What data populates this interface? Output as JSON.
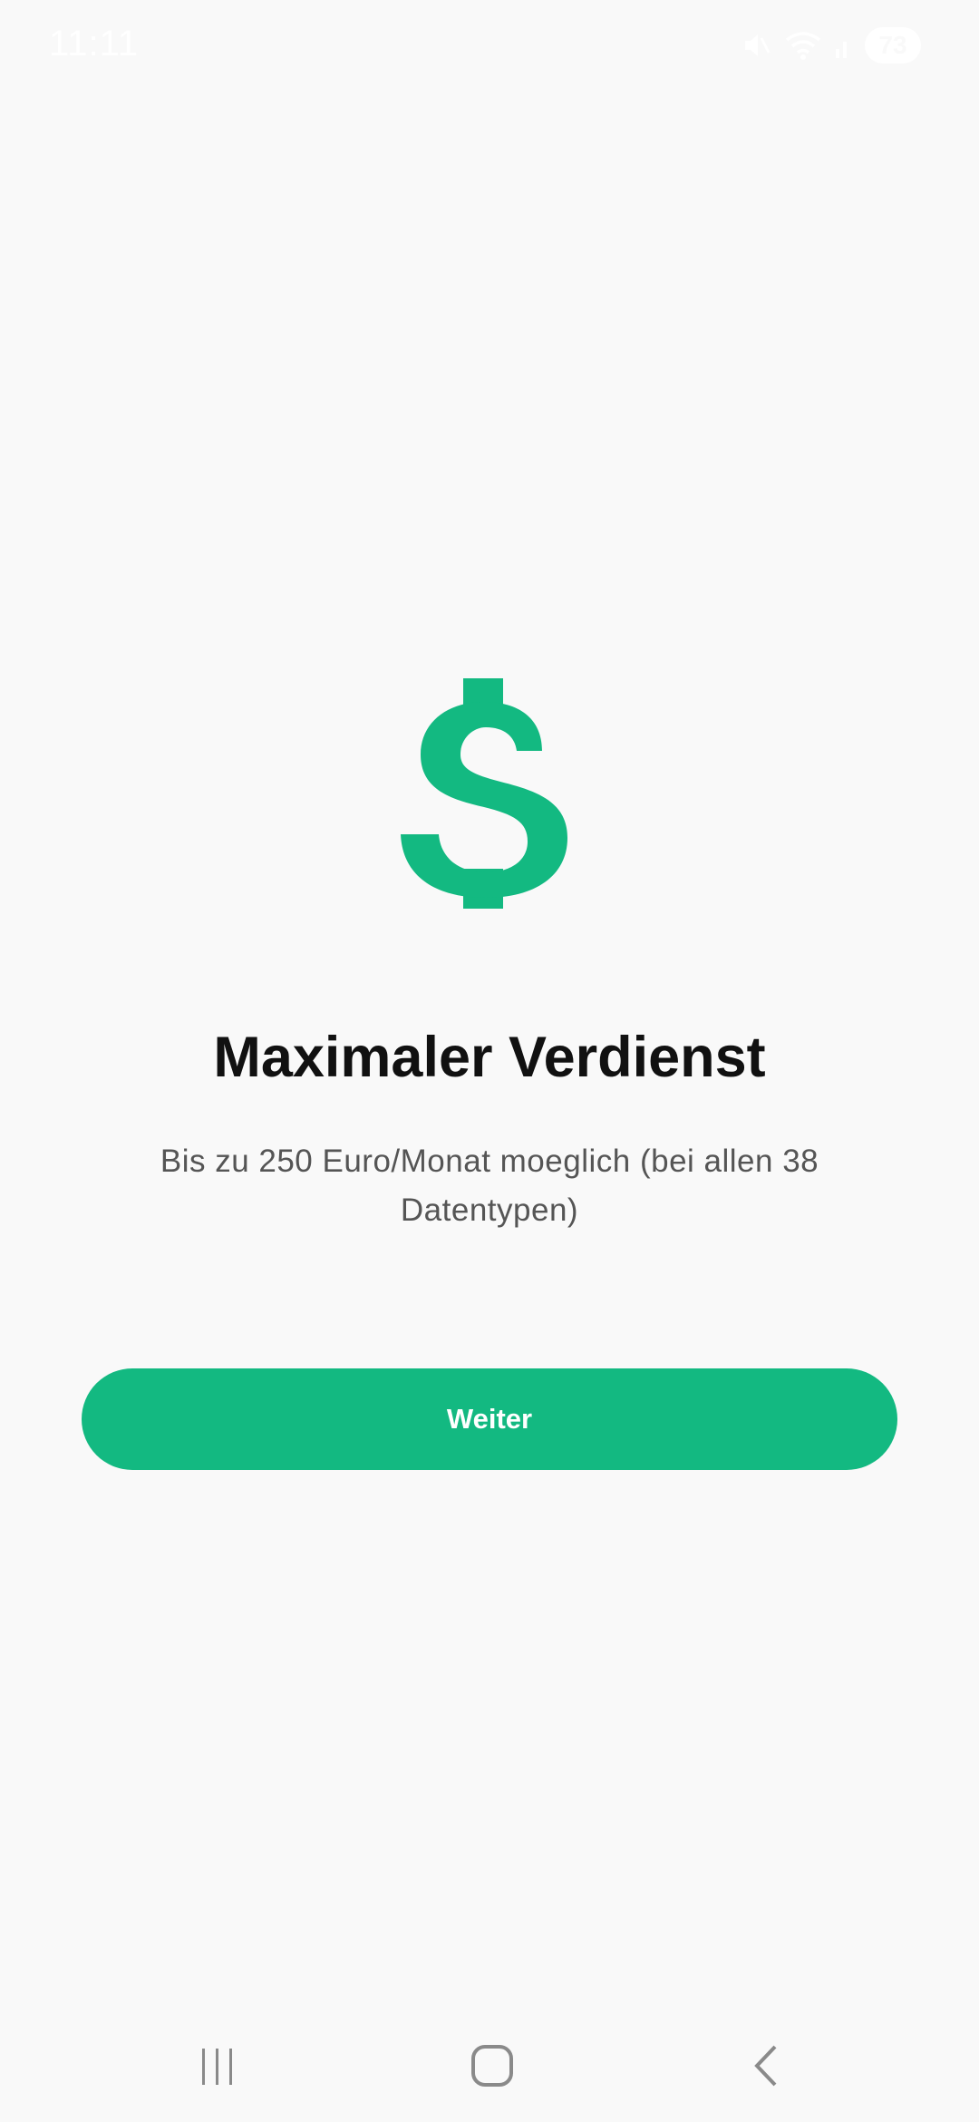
{
  "status_bar": {
    "time": "11:11",
    "battery": "73",
    "icons": [
      "mute-icon",
      "wifi-icon",
      "signal-icon",
      "battery-icon"
    ]
  },
  "onboarding": {
    "icon": "dollar-icon",
    "title": "Maximaler Verdienst",
    "subtitle": "Bis zu 250 Euro/Monat moeglich (bei allen 38 Datentypen)",
    "button_label": "Weiter",
    "accent_color": "#13b981"
  },
  "nav_bar": {
    "items": [
      "recents-icon",
      "home-icon",
      "back-icon"
    ]
  }
}
